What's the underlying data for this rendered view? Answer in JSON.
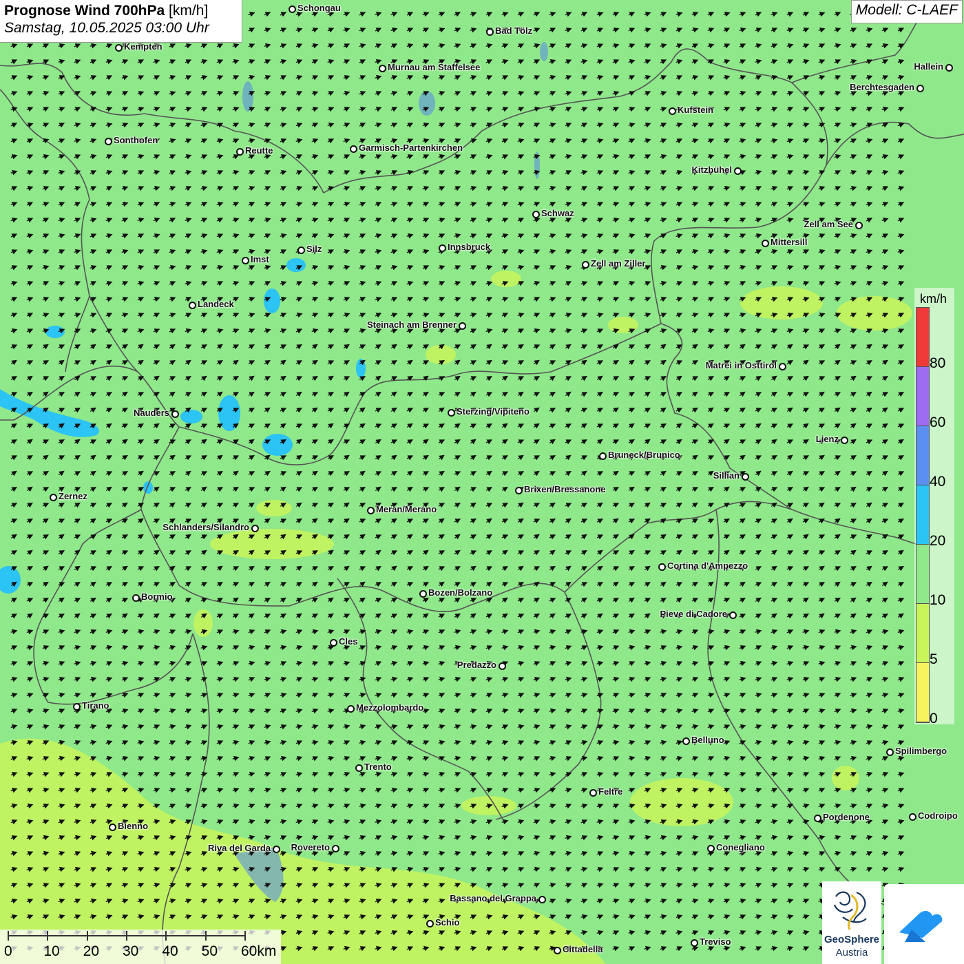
{
  "header": {
    "title_bold": "Prognose Wind 700hPa",
    "title_unit": "[km/h]",
    "subtitle": "Samstag, 10.05.2025 03:00 Uhr"
  },
  "model": "Modell: C-LAEF",
  "legend": {
    "unit": "km/h",
    "ticks": [
      "80",
      "60",
      "40",
      "20",
      "10",
      "5",
      "0"
    ],
    "colors": [
      "#f03a3a",
      "#9d6cf0",
      "#5b8ff0",
      "#2cc3f5",
      "#8fe88a",
      "#c9f55a",
      "#f7f35e"
    ]
  },
  "scale": {
    "labels": [
      "0",
      "10",
      "20",
      "30",
      "40",
      "50",
      "60km"
    ]
  },
  "logos": {
    "geosphere_name": "GeoSphere",
    "geosphere_sub": "Austria"
  },
  "colors": {
    "background": "#8fe88a",
    "low_wind": "#c9f55a",
    "high_wind": "#2cc3f5",
    "arrow": "#111111",
    "border_line": "#555555"
  },
  "cities": [
    {
      "name": "Schongau"
    },
    {
      "name": "Bad Tölz"
    },
    {
      "name": "Kempten"
    },
    {
      "name": "Murnau am Staffelsee"
    },
    {
      "name": "Hallein"
    },
    {
      "name": "Berchtesgaden"
    },
    {
      "name": "Kufstein"
    },
    {
      "name": "Sonthofen"
    },
    {
      "name": "Reutte"
    },
    {
      "name": "Garmisch-Partenkirchen"
    },
    {
      "name": "Kitzbühel"
    },
    {
      "name": "Schwaz"
    },
    {
      "name": "Zell am See"
    },
    {
      "name": "Mittersill"
    },
    {
      "name": "Innsbruck"
    },
    {
      "name": "Silz"
    },
    {
      "name": "Imst"
    },
    {
      "name": "Zell am Ziller"
    },
    {
      "name": "Landeck"
    },
    {
      "name": "Steinach am Brenner"
    },
    {
      "name": "Matrei in Osttirol"
    },
    {
      "name": "Nauders"
    },
    {
      "name": "Sterzing/Vipiteno"
    },
    {
      "name": "Lienz"
    },
    {
      "name": "Bruneck/Brunico"
    },
    {
      "name": "Sillian"
    },
    {
      "name": "Zernez"
    },
    {
      "name": "Brixen/Bressanone"
    },
    {
      "name": "Meran/Merano"
    },
    {
      "name": "Schlanders/Silandro"
    },
    {
      "name": "Cortina d'Ampezzo"
    },
    {
      "name": "Bozen/Bolzano"
    },
    {
      "name": "Bormio"
    },
    {
      "name": "Pieve di Cadore"
    },
    {
      "name": "Cles"
    },
    {
      "name": "Predazzo"
    },
    {
      "name": "Tirano"
    },
    {
      "name": "Mezzolombardo"
    },
    {
      "name": "Belluno"
    },
    {
      "name": "Spilimbergo"
    },
    {
      "name": "Trento"
    },
    {
      "name": "Feltre"
    },
    {
      "name": "Pordenone"
    },
    {
      "name": "Codroipo"
    },
    {
      "name": "Bienno"
    },
    {
      "name": "Riva del Garda"
    },
    {
      "name": "Rovereto"
    },
    {
      "name": "Conegliano"
    },
    {
      "name": "Bassano del Grappa"
    },
    {
      "name": "Schio"
    },
    {
      "name": "Treviso"
    },
    {
      "name": "Cittadella"
    }
  ]
}
